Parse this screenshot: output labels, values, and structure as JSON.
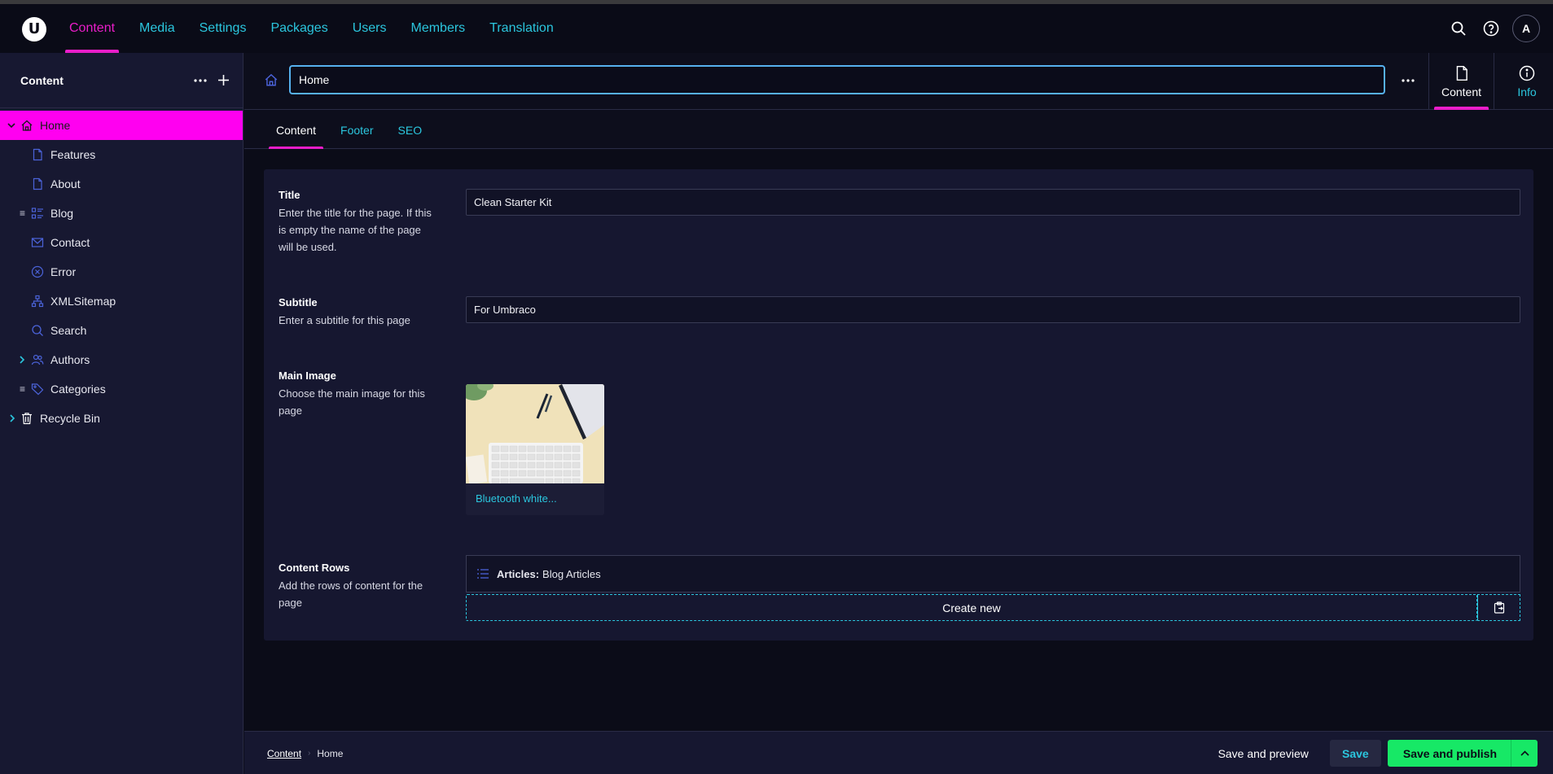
{
  "app": {
    "logo_letter": "U",
    "nav": [
      "Content",
      "Media",
      "Settings",
      "Packages",
      "Users",
      "Members",
      "Translation"
    ],
    "active_nav": "Content",
    "user_initial": "A",
    "accent_color": "#e91dc9",
    "link_color": "#2bc6de",
    "publish_color": "#17e866"
  },
  "sidebar": {
    "title": "Content",
    "tree": [
      {
        "label": "Home",
        "icon": "home-icon",
        "expanded": true,
        "active": true
      },
      {
        "label": "Features",
        "icon": "document-icon"
      },
      {
        "label": "About",
        "icon": "document-icon"
      },
      {
        "label": "Blog",
        "icon": "list-view-icon"
      },
      {
        "label": "Contact",
        "icon": "mail-icon"
      },
      {
        "label": "Error",
        "icon": "error-circle-icon"
      },
      {
        "label": "XMLSitemap",
        "icon": "sitemap-icon"
      },
      {
        "label": "Search",
        "icon": "search-icon"
      },
      {
        "label": "Authors",
        "icon": "users-icon",
        "expandable": true
      },
      {
        "label": "Categories",
        "icon": "tags-icon"
      },
      {
        "label": "Recycle Bin",
        "icon": "trash-icon",
        "expandable": true
      }
    ]
  },
  "editor": {
    "name_value": "Home",
    "views": {
      "content": "Content",
      "info": "Info"
    },
    "tabs": [
      "Content",
      "Footer",
      "SEO"
    ],
    "active_tab": "Content",
    "properties": {
      "title": {
        "label": "Title",
        "description": "Enter the title for the page. If this is empty the name of the page will be used.",
        "value": "Clean Starter Kit"
      },
      "subtitle": {
        "label": "Subtitle",
        "description": "Enter a subtitle for this page",
        "value": "For Umbraco"
      },
      "main_image": {
        "label": "Main Image",
        "description": "Choose the main image for this page",
        "media_name": "Bluetooth white..."
      },
      "content_rows": {
        "label": "Content Rows",
        "description": "Add the rows of content for the page",
        "row_type": "Articles:",
        "row_value": "Blog Articles",
        "create_label": "Create new"
      }
    }
  },
  "footer": {
    "breadcrumb": [
      "Content",
      "Home"
    ],
    "save_preview_label": "Save and preview",
    "save_label": "Save",
    "publish_label": "Save and publish"
  }
}
